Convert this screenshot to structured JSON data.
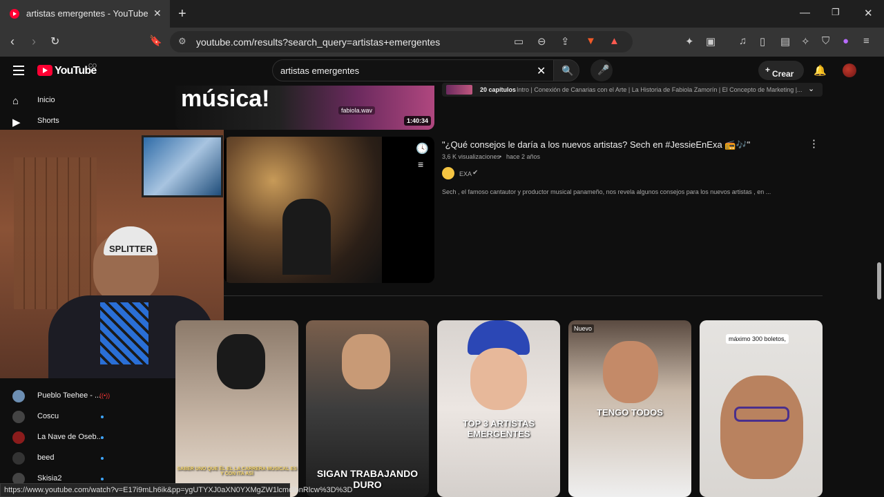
{
  "browser": {
    "tab_title": "artistas emergentes - YouTube",
    "url": "youtube.com/results?search_query=artistas+emergentes",
    "status_url": "https://www.youtube.com/watch?v=E17i9mLh6ik&pp=ygUTYXJ0aXN0YXMgZW1lcmdlbnRlcw%3D%3D"
  },
  "header": {
    "logo_text": "YouTube",
    "country_code": "CO",
    "search_value": "artistas emergentes",
    "create_label": "Crear"
  },
  "sidebar": {
    "items": [
      {
        "label": "Inicio",
        "icon": "home-icon"
      },
      {
        "label": "Shorts",
        "icon": "shorts-icon"
      }
    ],
    "subscriptions": [
      {
        "label": "Pueblo Teehee - ...",
        "color": "#6d8fb3"
      },
      {
        "label": "Coscu",
        "color": "#444"
      },
      {
        "label": "La Nave de Oseb...",
        "color": "#8b1c1c"
      },
      {
        "label": "beed",
        "color": "#333"
      },
      {
        "label": "Skisia2",
        "color": "#444"
      }
    ]
  },
  "results": {
    "top": {
      "thumb_text": "música!",
      "thumb_watermark": "fabiola.wav",
      "duration": "1:40:34",
      "chapters_label": "20 capítulos",
      "chapters_text": "Intro | Conexión de Canarias con el Arte | La Historia de Fabiola Zamorín | El Concepto de Marketing |..."
    },
    "video": {
      "title": "\"¿Qué consejos le daría a los nuevos artistas? Sech en #JessieEnExa 📻🎶\"",
      "views": "3,6 K visualizaciones",
      "age": "hace 2 años",
      "channel": "EXA",
      "description": "Sech , el famoso cantautor y productor musical panameño, nos revela algunos consejos para los nuevos artistas , en ..."
    },
    "shorts": [
      {
        "overlay": "SABER UNO QUE ÉL EL LA CARRERA MUSICAL ES Y CON ITA ASÍ",
        "badge": ""
      },
      {
        "overlay": "SIGAN TRABAJANDO DURO",
        "badge": ""
      },
      {
        "overlay": "TOP 3 ARTISTAS EMERGENTES",
        "badge": ""
      },
      {
        "overlay": "TENGO TODOS",
        "badge": "Nuevo"
      },
      {
        "overlay": "máximo 300 boletos,",
        "badge": ""
      }
    ]
  }
}
